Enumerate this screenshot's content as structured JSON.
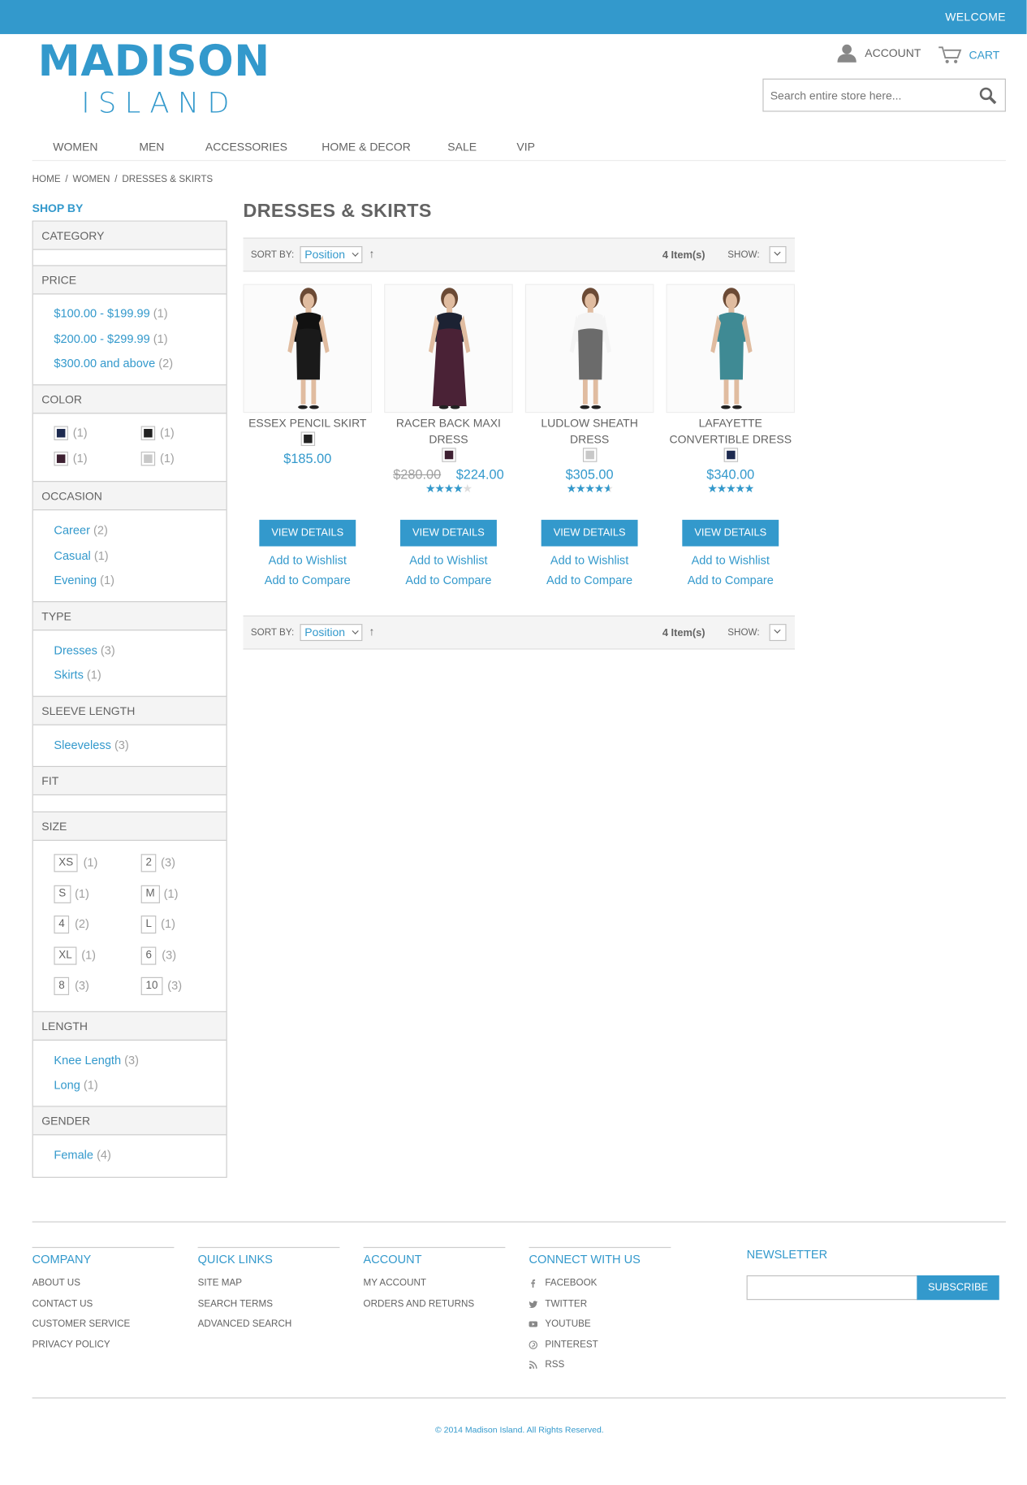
{
  "header": {
    "welcome": "WELCOME",
    "logo_main": "MADISON",
    "logo_sub": "ISLAND",
    "account": "ACCOUNT",
    "cart": "CART",
    "search_placeholder": "Search entire store here..."
  },
  "nav": [
    "WOMEN",
    "MEN",
    "ACCESSORIES",
    "HOME & DECOR",
    "SALE",
    "VIP"
  ],
  "breadcrumb": [
    "HOME",
    "WOMEN",
    "DRESSES & SKIRTS"
  ],
  "breadcrumb_sep": "/",
  "sidebar": {
    "shop_by": "SHOP BY",
    "category": "CATEGORY",
    "price": {
      "title": "PRICE",
      "items": [
        {
          "label": "$100.00 - $199.99",
          "count": "(1)"
        },
        {
          "label": "$200.00 - $299.99",
          "count": "(1)"
        },
        {
          "label": "$300.00 and above",
          "count": "(2)"
        }
      ]
    },
    "color": {
      "title": "COLOR",
      "items": [
        {
          "color": "#1d2a50",
          "count": "(1)"
        },
        {
          "color": "#222222",
          "count": "(1)"
        },
        {
          "color": "#3e2032",
          "count": "(1)"
        },
        {
          "color": "#c8c8c8",
          "count": "(1)"
        }
      ]
    },
    "occasion": {
      "title": "OCCASION",
      "items": [
        {
          "label": "Career",
          "count": "(2)"
        },
        {
          "label": "Casual",
          "count": "(1)"
        },
        {
          "label": "Evening",
          "count": "(1)"
        }
      ]
    },
    "type": {
      "title": "TYPE",
      "items": [
        {
          "label": "Dresses",
          "count": "(3)"
        },
        {
          "label": "Skirts",
          "count": "(1)"
        }
      ]
    },
    "sleeve": {
      "title": "SLEEVE LENGTH",
      "items": [
        {
          "label": "Sleeveless",
          "count": "(3)"
        }
      ]
    },
    "fit": "FIT",
    "size": {
      "title": "SIZE",
      "items": [
        {
          "label": "XS",
          "count": "(1)"
        },
        {
          "label": "2",
          "count": "(3)"
        },
        {
          "label": "S",
          "count": "(1)"
        },
        {
          "label": "M",
          "count": "(1)"
        },
        {
          "label": "4",
          "count": "(2)"
        },
        {
          "label": "L",
          "count": "(1)"
        },
        {
          "label": "XL",
          "count": "(1)"
        },
        {
          "label": "6",
          "count": "(3)"
        },
        {
          "label": "8",
          "count": "(3)"
        },
        {
          "label": "10",
          "count": "(3)"
        }
      ]
    },
    "length": {
      "title": "LENGTH",
      "items": [
        {
          "label": "Knee Length",
          "count": "(3)"
        },
        {
          "label": "Long",
          "count": "(1)"
        }
      ]
    },
    "gender": {
      "title": "GENDER",
      "items": [
        {
          "label": "Female",
          "count": "(4)"
        }
      ]
    }
  },
  "main": {
    "title": "DRESSES & SKIRTS",
    "toolbar": {
      "sort_by": "SORT BY:",
      "sort_value": "Position",
      "sort_arrow": "↑",
      "items": "4 Item(s)",
      "show": "SHOW:"
    },
    "products": [
      {
        "name": "ESSEX PENCIL SKIRT",
        "swatch": "#222222",
        "old_price": "",
        "price": "$185.00",
        "rating": 0,
        "dress": "#1a1a1a",
        "top": "#111111",
        "skin": "#e0bca0"
      },
      {
        "name": "RACER BACK MAXI DRESS",
        "swatch": "#3e2032",
        "old_price": "$280.00",
        "price": "$224.00",
        "rating": 0.8,
        "dress": "#4a2236",
        "top": "#1c2233",
        "skin": "#e0bca0"
      },
      {
        "name": "LUDLOW SHEATH DRESS",
        "swatch": "#c8c8c8",
        "old_price": "",
        "price": "$305.00",
        "rating": 0.93,
        "dress": "#6b6b6b",
        "top": "#f4f4f4",
        "skin": "#e0bca0"
      },
      {
        "name": "LAFAYETTE CONVERTIBLE DRESS",
        "swatch": "#1d2a50",
        "old_price": "",
        "price": "$340.00",
        "rating": 1.0,
        "dress": "#3f8a94",
        "top": "#3f8a94",
        "skin": "#e0bca0"
      }
    ],
    "view_details": "VIEW DETAILS",
    "add_wishlist": "Add to Wishlist",
    "add_compare": "Add to Compare"
  },
  "footer": {
    "company": {
      "title": "COMPANY",
      "links": [
        "ABOUT US",
        "CONTACT US",
        "CUSTOMER SERVICE",
        "PRIVACY POLICY"
      ]
    },
    "quick": {
      "title": "QUICK LINKS",
      "links": [
        "SITE MAP",
        "SEARCH TERMS",
        "ADVANCED SEARCH"
      ]
    },
    "account": {
      "title": "ACCOUNT",
      "links": [
        "MY ACCOUNT",
        "ORDERS AND RETURNS"
      ]
    },
    "connect": {
      "title": "CONNECT WITH US",
      "links": [
        {
          "label": "FACEBOOK",
          "icon": "facebook-icon"
        },
        {
          "label": "TWITTER",
          "icon": "twitter-icon"
        },
        {
          "label": "YOUTUBE",
          "icon": "youtube-icon"
        },
        {
          "label": "PINTEREST",
          "icon": "pinterest-icon"
        },
        {
          "label": "RSS",
          "icon": "rss-icon"
        }
      ]
    },
    "newsletter": {
      "title": "NEWSLETTER",
      "button": "SUBSCRIBE"
    },
    "copyright": "© 2014 Madison Island. All Rights Reserved."
  },
  "colors": {
    "accent": "#3399cc",
    "text": "#636363",
    "muted": "#a0a0a0",
    "panel": "#f4f4f4"
  }
}
